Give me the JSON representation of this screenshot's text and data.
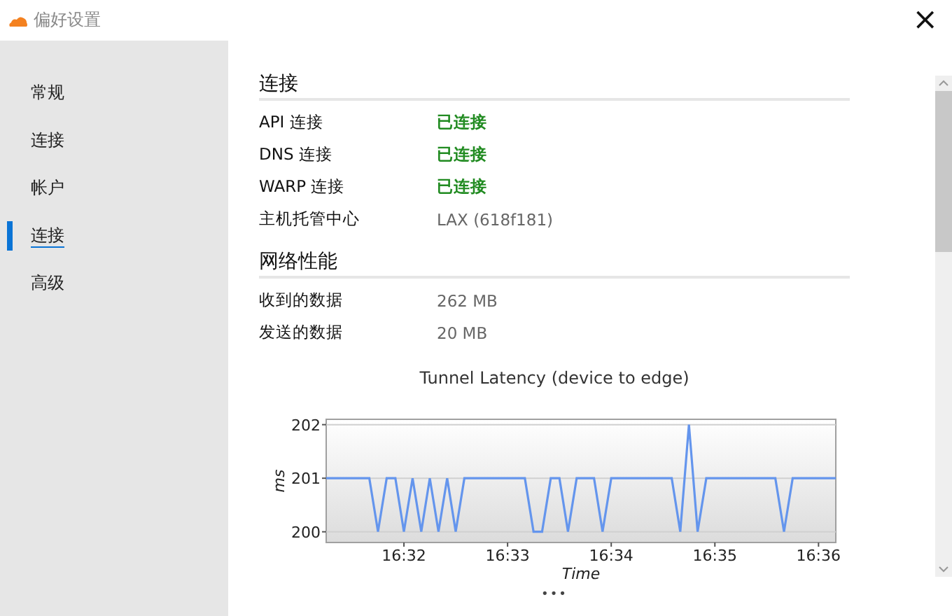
{
  "window": {
    "title": "偏好设置",
    "close": "×"
  },
  "sidebar": {
    "items": [
      {
        "label": "常规",
        "selected": false
      },
      {
        "label": "连接",
        "selected": false
      },
      {
        "label": "帐户",
        "selected": false
      },
      {
        "label": "连接",
        "selected": true
      },
      {
        "label": "高级",
        "selected": false
      }
    ]
  },
  "sections": [
    {
      "heading": "连接",
      "rows": [
        {
          "label": "API 连接",
          "value": "已连接",
          "kind": "status"
        },
        {
          "label": "DNS 连接",
          "value": "已连接",
          "kind": "status"
        },
        {
          "label": "WARP 连接",
          "value": "已连接",
          "kind": "status"
        },
        {
          "label": "主机托管中心",
          "value": "LAX (618f181)",
          "kind": "plain"
        }
      ]
    },
    {
      "heading": "网络性能",
      "rows": [
        {
          "label": "收到的数据",
          "value": "262 MB",
          "kind": "plain"
        },
        {
          "label": "发送的数据",
          "value": "20 MB",
          "kind": "plain"
        }
      ]
    }
  ],
  "chart": {
    "chart_data": {
      "type": "line",
      "title": "Tunnel Latency (device to edge)",
      "xlabel": "Time",
      "ylabel": "ms",
      "categories": [
        null,
        null,
        null,
        null,
        null,
        null,
        null,
        null,
        null,
        "16:32",
        null,
        null,
        null,
        null,
        null,
        null,
        null,
        null,
        null,
        null,
        null,
        "16:33",
        null,
        null,
        null,
        null,
        null,
        null,
        null,
        null,
        null,
        null,
        null,
        "16:34",
        null,
        null,
        null,
        null,
        null,
        null,
        null,
        null,
        null,
        null,
        null,
        "16:35",
        null,
        null,
        null,
        null,
        null,
        null,
        null,
        null,
        null,
        null,
        null,
        "16:36",
        null,
        null
      ],
      "series": [
        {
          "color": "#6495ed",
          "values": [
            201,
            201,
            201,
            201,
            201,
            201,
            200,
            201,
            201,
            200,
            201,
            200,
            201,
            200,
            201,
            200,
            201,
            201,
            201,
            201,
            201,
            201,
            201,
            201,
            200,
            200,
            201,
            201,
            200,
            201,
            201,
            201,
            200,
            201,
            201,
            201,
            201,
            201,
            201,
            201,
            201,
            200,
            202,
            200,
            201,
            201,
            201,
            201,
            201,
            201,
            201,
            201,
            201,
            200,
            201,
            201,
            201,
            201,
            201,
            201
          ]
        }
      ],
      "ylim": [
        199.8,
        202.1
      ],
      "grid": true,
      "yticks": [
        200,
        201,
        202
      ]
    },
    "more": "•••"
  }
}
